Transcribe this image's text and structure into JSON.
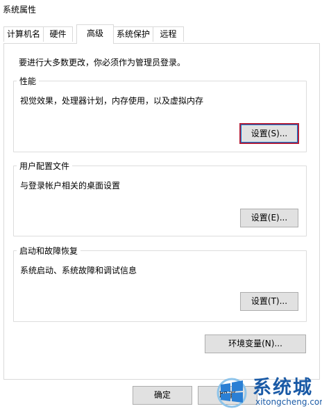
{
  "window": {
    "title": "系统属性"
  },
  "tabs": [
    {
      "label": "计算机名"
    },
    {
      "label": "硬件"
    },
    {
      "label": "高级"
    },
    {
      "label": "系统保护"
    },
    {
      "label": "远程"
    }
  ],
  "active_tab": "高级",
  "login_note": "要进行大多数更改，你必须作为管理员登录。",
  "performance": {
    "legend": "性能",
    "desc": "视觉效果，处理器计划，内存使用，以及虚拟内存",
    "button": "设置(S)..."
  },
  "user_profiles": {
    "legend": "用户配置文件",
    "desc": "与登录帐户相关的桌面设置",
    "button": "设置(E)..."
  },
  "startup_recovery": {
    "legend": "启动和故障恢复",
    "desc": "系统启动、系统故障和调试信息",
    "button": "设置(T)..."
  },
  "env_button": "环境变量(N)...",
  "footer": {
    "ok": "确定",
    "cancel": "取消"
  },
  "watermark": {
    "title": "系统城",
    "url": "xitongcheng.com"
  },
  "colors": {
    "focus_border": "#b2203a",
    "watermark_blue": "#1a5aa6"
  }
}
